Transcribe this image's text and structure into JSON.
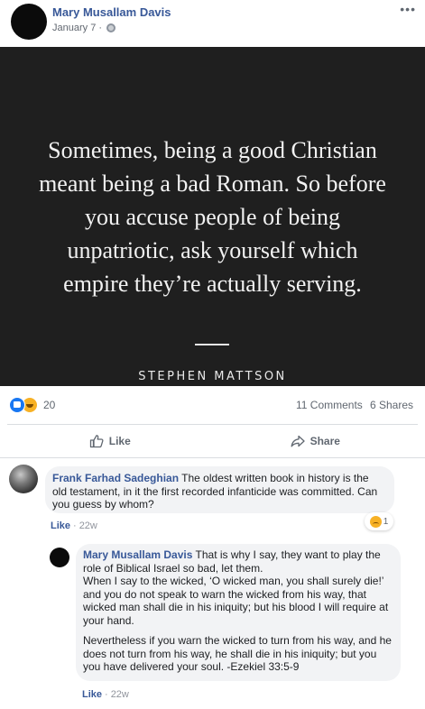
{
  "post": {
    "author": "Mary Musallam Davis",
    "date": "January 7",
    "separator": "·",
    "more_label": "•••"
  },
  "image": {
    "quote": "Sometimes, being a good Christian\nmeant being a bad Roman. So before\nyou accuse people of being\nunpatriotic, ask yourself which\nempire they’re actually serving.",
    "quote_author": "STEPHEN MATTSON"
  },
  "stats": {
    "reactions_count": "20",
    "comments": "11 Comments",
    "shares": "6 Shares"
  },
  "actions": {
    "like": "Like",
    "share": "Share"
  },
  "comments": [
    {
      "author": "Frank Farhad Sadeghian",
      "text": "The oldest written book in history is the old testament, in it the first recorded infanticide was committed. Can you guess by whom?",
      "like": "Like",
      "sep": "·",
      "time": "22w",
      "reaction_count": "1"
    },
    {
      "author": "Mary Musallam Davis",
      "text": "That is why I say, they want to play the role of Biblical Israel so bad, let them.",
      "text2": "When I say to the wicked, ‘O wicked man, you shall surely die!’ and you do not speak to warn the wicked from his way, that wicked man shall die in his iniquity; but his blood I will require at your hand.",
      "text3": "Nevertheless if you warn the wicked to turn from his way, and he does not turn from his way, he shall die in his iniquity; but you you have delivered your soul. -Ezekiel 33:5-9",
      "like": "Like",
      "sep": "·",
      "time": "22w"
    }
  ],
  "colors": {
    "link": "#385898",
    "like_blue": "#1877f2",
    "image_bg": "#1f1f1f",
    "bubble_bg": "#f2f3f5"
  }
}
